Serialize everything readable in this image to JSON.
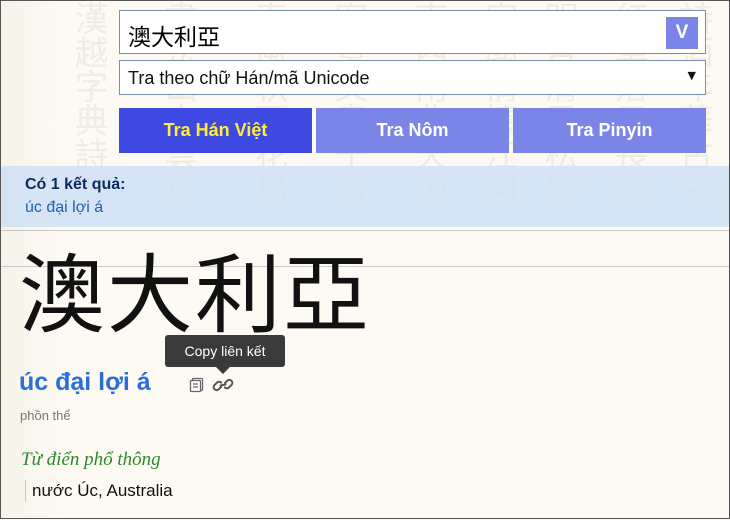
{
  "search": {
    "query": "澳大利亞",
    "submit_label": "V"
  },
  "mode": {
    "selected": "Tra theo chữ Hán/mã Unicode",
    "arrow": "▼"
  },
  "tabs": [
    {
      "label": "Tra Hán Việt",
      "active": true
    },
    {
      "label": "Tra Nôm",
      "active": false
    },
    {
      "label": "Tra Pinyin",
      "active": false
    }
  ],
  "results": {
    "count_text": "Có 1 kết quả:",
    "items": [
      "úc đại lợi á"
    ]
  },
  "entry": {
    "word": "澳大利亞",
    "reading": "úc đại lợi á",
    "variant": "phồn thể",
    "tooltip": "Copy liên kết",
    "dictionary": "Từ điển phổ thông",
    "definition": "nước Úc, Australia"
  },
  "colors": {
    "active_tab": "#3d49e0",
    "active_tab_text": "#ffec3b",
    "tab": "#7b85e8",
    "result_band": "#cfe0f4",
    "reading": "#2a6fd6",
    "dictionary": "#2b8a2b"
  },
  "icons": [
    "copy-icon",
    "link-icon"
  ]
}
